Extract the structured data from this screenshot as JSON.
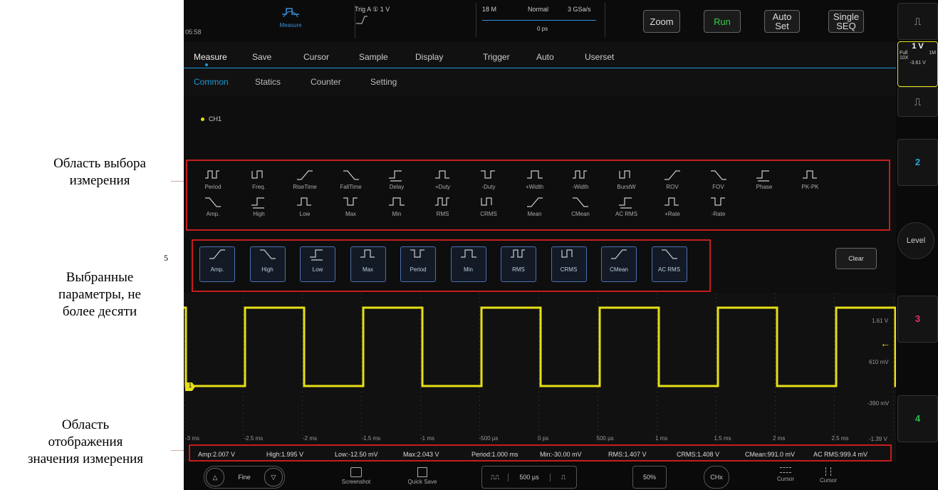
{
  "annotations": {
    "select_area": "Область выбора\nизмерения",
    "selected_params": "Выбранные\nпараметры, не\nболее десяти",
    "value_area": "Область\nотображения\nзначения измерения",
    "marker_5": "5"
  },
  "topbar": {
    "time": "05:58",
    "measure_label": "Measure",
    "trig": "Trig A  ① 1 V",
    "acq_depth": "18 M",
    "acq_mode": "Normal",
    "sample_rate": "3 GSa/s",
    "offset": "0 ps",
    "zoom": "Zoom",
    "run": "Run",
    "auto_set": "Auto\nSet",
    "single": "Single\nSEQ"
  },
  "menu": [
    "Measure",
    "Save",
    "Cursor",
    "Sample",
    "Display",
    "Trigger",
    "Auto",
    "Userset"
  ],
  "submenu": [
    "Common",
    "Statics",
    "Counter",
    "Setting"
  ],
  "channel_tag": "CH1",
  "measure_row1": [
    "Period",
    "Freq.",
    "RiseTime",
    "FallTime",
    "Delay",
    "+Duty",
    "-Duty",
    "+Width",
    "-Width",
    "BurstW",
    "ROV",
    "FOV",
    "Phase",
    "PK-PK"
  ],
  "measure_row2": [
    "Amp.",
    "High",
    "Low",
    "Max",
    "Min",
    "RMS",
    "CRMS",
    "Mean",
    "CMean",
    "AC RMS",
    "+Rate",
    "-Rate"
  ],
  "selected": [
    "Amp.",
    "High",
    "Low",
    "Max",
    "Period",
    "Min",
    "RMS",
    "CRMS",
    "CMean",
    "AC RMS"
  ],
  "clear": "Clear",
  "wave_labels": {
    "v1": "1.61 V",
    "v2": "610 mV",
    "v3": "-390 mV",
    "v4": "-1.39 V",
    "ch_marker": "1"
  },
  "time_ticks": [
    "-3 ms",
    "-2.5 ms",
    "-2 ms",
    "-1.5 ms",
    "-1 ms",
    "-500 µs",
    "0 ps",
    "500 µs",
    "1 ms",
    "1.5 ms",
    "2 ms",
    "2.5 ms"
  ],
  "measurements": [
    "Amp:2.007 V",
    "High:1.995 V",
    "Low:-12.50 mV",
    "Max:2.043 V",
    "Period:1.000 ms",
    "Min:-30.00 mV",
    "RMS:1.407 V",
    "CRMS:1.408 V",
    "CMean:991.0 mV",
    "AC RMS:999.4 mV"
  ],
  "right_bar": {
    "ch1_v": "1 V",
    "ch1_full": "Full",
    "ch1_imp": "1M",
    "ch1_probe": "10X",
    "ch1_off": "-3.61 V",
    "ch2": "2",
    "level": "Level",
    "ch3": "3",
    "ch4": "4"
  },
  "bottom": {
    "fine": "Fine",
    "screenshot": "Screenshot",
    "quick_save": "Quick Save",
    "timebase": "500 µs",
    "pct": "50%",
    "chx": "CHx",
    "cursor1": "Cursor",
    "cursor2": "Cursor"
  },
  "colors": {
    "trace": "#e6e016",
    "accent": "#1e9ad6",
    "red": "#c61d1d",
    "run": "#2fd14a",
    "ch2": "#2aa7d8",
    "ch3": "#e0307a",
    "ch4": "#27c04a"
  }
}
